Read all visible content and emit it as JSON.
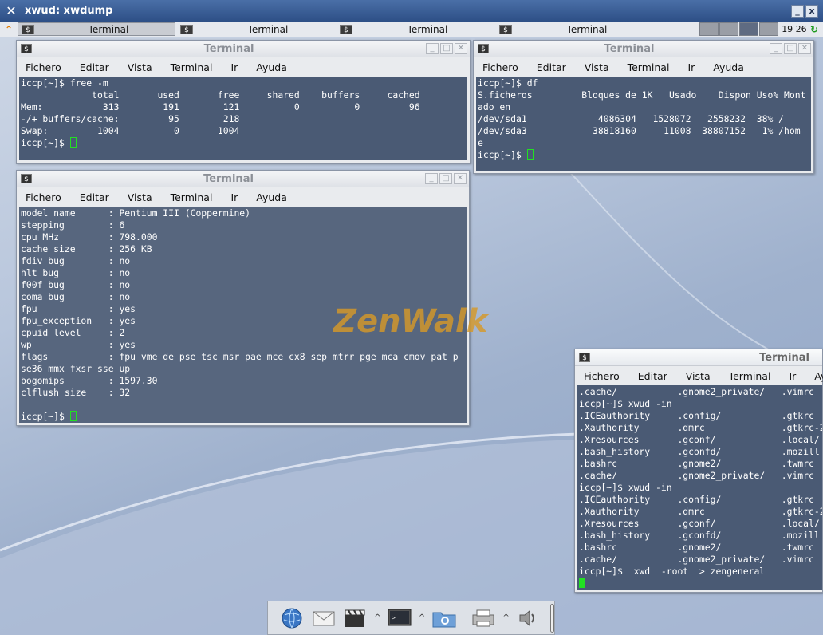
{
  "xwud": {
    "title": "xwud: xwdump",
    "buttons": [
      "_",
      "x"
    ]
  },
  "taskbar": {
    "tasks": [
      {
        "label": "Terminal",
        "active": true
      },
      {
        "label": "Terminal",
        "active": false
      },
      {
        "label": "Terminal",
        "active": false
      },
      {
        "label": "Terminal",
        "active": false
      }
    ],
    "clock": "19 26"
  },
  "menu": [
    "Fichero",
    "Editar",
    "Vista",
    "Terminal",
    "Ir",
    "Ayuda"
  ],
  "terminals": [
    {
      "id": "free",
      "title": "Terminal",
      "lines": [
        "iccp[~]$ free -m",
        "             total       used       free     shared    buffers     cached",
        "Mem:           313        191        121          0          0         96",
        "-/+ buffers/cache:         95        218",
        "Swap:         1004          0       1004",
        "iccp[~]$ "
      ]
    },
    {
      "id": "df",
      "title": "Terminal",
      "lines": [
        "iccp[~]$ df",
        "S.ficheros         Bloques de 1K   Usado    Dispon Uso% Mont",
        "ado en",
        "/dev/sda1             4086304   1528072   2558232  38% /",
        "/dev/sda3            38818160     11008  38807152   1% /hom",
        "e",
        "iccp[~]$ "
      ]
    },
    {
      "id": "cpuinfo",
      "title": "Terminal",
      "lines": [
        "model name      : Pentium III (Coppermine)",
        "stepping        : 6",
        "cpu MHz         : 798.000",
        "cache size      : 256 KB",
        "fdiv_bug        : no",
        "hlt_bug         : no",
        "f00f_bug        : no",
        "coma_bug        : no",
        "fpu             : yes",
        "fpu_exception   : yes",
        "cpuid level     : 2",
        "wp              : yes",
        "flags           : fpu vme de pse tsc msr pae mce cx8 sep mtrr pge mca cmov pat p",
        "se36 mmx fxsr sse up",
        "bogomips        : 1597.30",
        "clflush size    : 32",
        "",
        "iccp[~]$ "
      ]
    },
    {
      "id": "ls",
      "title": "Terminal",
      "lines": [
        ".cache/           .gnome2_private/   .vimrc",
        "iccp[~]$ xwud -in",
        ".ICEauthority     .config/           .gtkrc",
        ".Xauthority       .dmrc              .gtkrc-2",
        ".Xresources       .gconf/            .local/",
        ".bash_history     .gconfd/           .mozill",
        ".bashrc           .gnome2/           .twmrc",
        ".cache/           .gnome2_private/   .vimrc",
        "iccp[~]$ xwud -in",
        ".ICEauthority     .config/           .gtkrc",
        ".Xauthority       .dmrc              .gtkrc-2",
        ".Xresources       .gconf/            .local/",
        ".bash_history     .gconfd/           .mozill",
        ".bashrc           .gnome2/           .twmrc",
        ".cache/           .gnome2_private/   .vimrc",
        "iccp[~]$  xwd  -root  > zengeneral",
        ""
      ]
    }
  ],
  "logo": {
    "wordmark": "ZenWalk"
  },
  "dock": {
    "icons": [
      "globe-icon",
      "mail-icon",
      "clapperboard-icon",
      "terminal-icon",
      "folder-search-icon",
      "printer-icon",
      "speaker-icon"
    ]
  },
  "colors": {
    "terminal_bg": "#4a5a74",
    "cursor": "#22e022",
    "titlebar": "#2d4f86",
    "logo": "#d49628"
  }
}
